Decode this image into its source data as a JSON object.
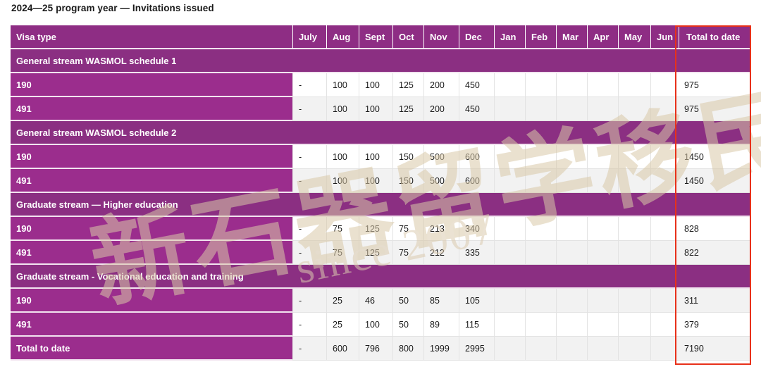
{
  "page_title": "2024—25 program year — Invitations issued",
  "watermark": {
    "cjk_text": "新石器留学移民",
    "latin_text": "since 2007"
  },
  "highlight": {
    "name": "total-to-date-column-highlight",
    "color": "#e8311a"
  },
  "colors": {
    "header_purple": "#8E2D84",
    "section_purple": "#8B2F82",
    "label_purple": "#9B2D8D",
    "row_alt_gray": "#f2f2f2",
    "row_white": "#ffffff",
    "highlight_red": "#e8311a"
  },
  "chart_data": {
    "type": "table",
    "title": "2024—25 program year — Invitations issued",
    "columns": [
      "Visa type",
      "July",
      "Aug",
      "Sept",
      "Oct",
      "Nov",
      "Dec",
      "Jan",
      "Feb",
      "Mar",
      "Apr",
      "May",
      "Jun",
      "Total to date"
    ],
    "rows": [
      {
        "kind": "section",
        "label": "General stream WASMOL schedule 1",
        "values": [
          "",
          "",
          "",
          "",
          "",
          "",
          "",
          "",
          "",
          "",
          "",
          "",
          ""
        ]
      },
      {
        "kind": "data",
        "label": "190",
        "values": [
          "-",
          "100",
          "100",
          "125",
          "200",
          "450",
          "",
          "",
          "",
          "",
          "",
          "",
          "975"
        ]
      },
      {
        "kind": "data",
        "label": "491",
        "values": [
          "-",
          "100",
          "100",
          "125",
          "200",
          "450",
          "",
          "",
          "",
          "",
          "",
          "",
          "975"
        ]
      },
      {
        "kind": "section",
        "label": "General stream WASMOL schedule 2",
        "values": [
          "",
          "",
          "",
          "",
          "",
          "",
          "",
          "",
          "",
          "",
          "",
          "",
          ""
        ]
      },
      {
        "kind": "data",
        "label": "190",
        "values": [
          "-",
          "100",
          "100",
          "150",
          "500",
          "600",
          "",
          "",
          "",
          "",
          "",
          "",
          "1450"
        ]
      },
      {
        "kind": "data",
        "label": "491",
        "values": [
          "-",
          "100",
          "100",
          "150",
          "500",
          "600",
          "",
          "",
          "",
          "",
          "",
          "",
          "1450"
        ]
      },
      {
        "kind": "section",
        "label": "Graduate stream — Higher education",
        "values": [
          "",
          "",
          "",
          "",
          "",
          "",
          "",
          "",
          "",
          "",
          "",
          "",
          ""
        ]
      },
      {
        "kind": "data",
        "label": "190",
        "values": [
          "-",
          "75",
          "125",
          "75",
          "213",
          "340",
          "",
          "",
          "",
          "",
          "",
          "",
          "828"
        ]
      },
      {
        "kind": "data",
        "label": "491",
        "values": [
          "-",
          "75",
          "125",
          "75",
          "212",
          "335",
          "",
          "",
          "",
          "",
          "",
          "",
          "822"
        ]
      },
      {
        "kind": "section",
        "label": "Graduate stream - Vocational education and training",
        "values": [
          "",
          "",
          "",
          "",
          "",
          "",
          "",
          "",
          "",
          "",
          "",
          "",
          ""
        ]
      },
      {
        "kind": "data",
        "label": "190",
        "values": [
          "-",
          "25",
          "46",
          "50",
          "85",
          "105",
          "",
          "",
          "",
          "",
          "",
          "",
          "311"
        ]
      },
      {
        "kind": "data",
        "label": "491",
        "values": [
          "-",
          "25",
          "100",
          "50",
          "89",
          "115",
          "",
          "",
          "",
          "",
          "",
          "",
          "379"
        ]
      },
      {
        "kind": "total",
        "label": "Total to date",
        "values": [
          "-",
          "600",
          "796",
          "800",
          "1999",
          "2995",
          "",
          "",
          "",
          "",
          "",
          "",
          "7190"
        ]
      }
    ]
  }
}
